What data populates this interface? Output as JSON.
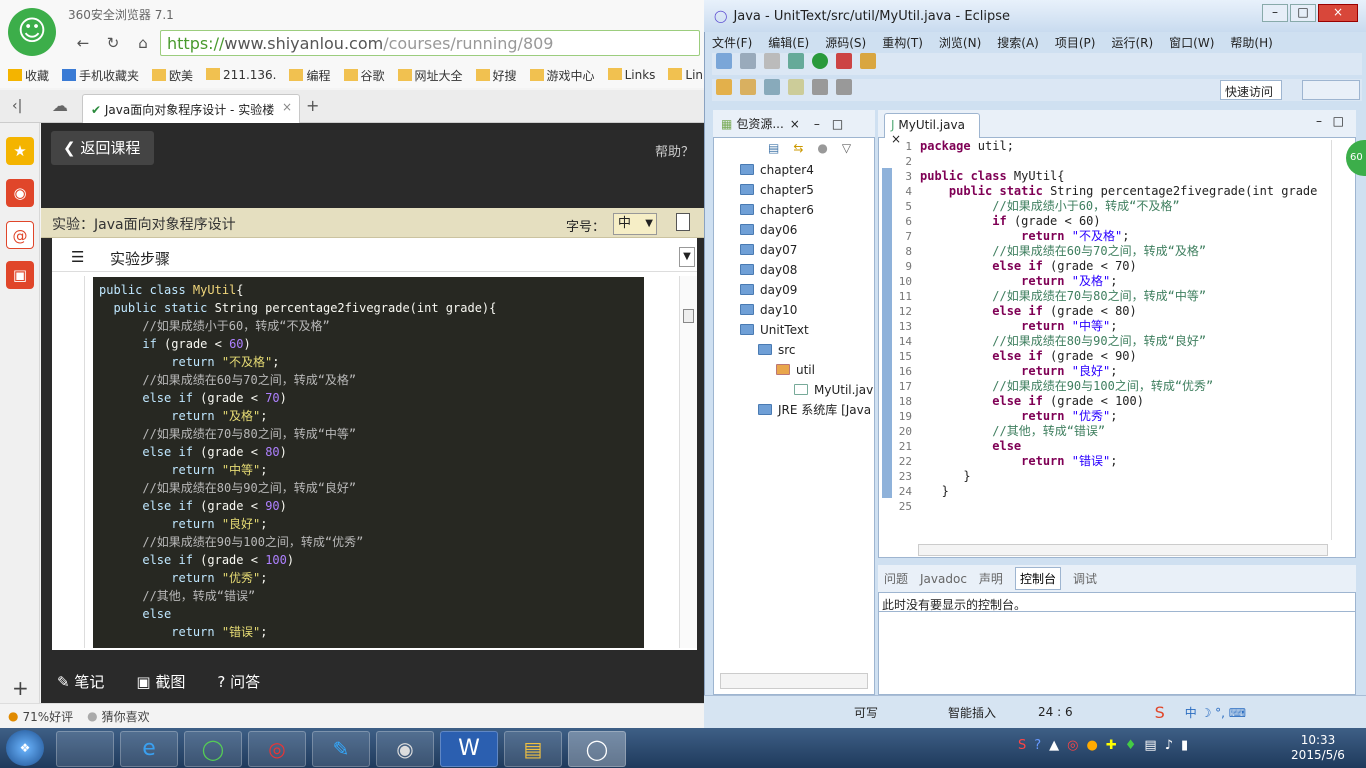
{
  "browser": {
    "app_title": "360安全浏览器 7.1",
    "url_secure": "https://",
    "url_host": "www.shiyanlou.com",
    "url_path": "/courses/running/809",
    "favorites": [
      "收藏",
      "手机收藏夹",
      "欧美",
      "211.136.",
      "编程",
      "谷歌",
      "网址大全",
      "好搜",
      "游戏中心",
      "Links",
      "Link"
    ],
    "tab_title": "Java面向对象程序设计 - 实验楼",
    "new_tab": "+",
    "back_course": "返回课程",
    "help": "帮助？",
    "lab_title": "实验：Java面向对象程序设计",
    "font_label": "字号：",
    "font_value": "中",
    "steps_label": "实验步骤",
    "bottom": {
      "notes": "笔记",
      "screenshot": "截图",
      "qa": "问答"
    },
    "status": {
      "rating": "71%好评",
      "guess": "猜你喜欢"
    },
    "side_add": "+"
  },
  "web_code": [
    [
      [
        "kw",
        "public class "
      ],
      [
        "cls",
        "MyUtil"
      ],
      [
        "",
        "{"
      ]
    ],
    [
      [
        "",
        "  "
      ],
      [
        "kw",
        "public static "
      ],
      [
        "",
        "String percentage2fivegrade(int grade){"
      ]
    ],
    [
      [
        "",
        "      "
      ],
      [
        "com",
        "//如果成绩小于60，转成“不及格”"
      ]
    ],
    [
      [
        "",
        "      "
      ],
      [
        "kw",
        "if "
      ],
      [
        "",
        "(grade < "
      ],
      [
        "num",
        "60"
      ],
      [
        "",
        ")"
      ]
    ],
    [
      [
        "",
        "          "
      ],
      [
        "kw",
        "return "
      ],
      [
        "str",
        "\"不及格\""
      ],
      [
        "",
        ";"
      ]
    ],
    [
      [
        "",
        "      "
      ],
      [
        "com",
        "//如果成绩在60与70之间，转成“及格”"
      ]
    ],
    [
      [
        "",
        "      "
      ],
      [
        "kw",
        "else if "
      ],
      [
        "",
        "(grade < "
      ],
      [
        "num",
        "70"
      ],
      [
        "",
        ")"
      ]
    ],
    [
      [
        "",
        "          "
      ],
      [
        "kw",
        "return "
      ],
      [
        "str",
        "\"及格\""
      ],
      [
        "",
        ";"
      ]
    ],
    [
      [
        "",
        "      "
      ],
      [
        "com",
        "//如果成绩在70与80之间，转成“中等”"
      ]
    ],
    [
      [
        "",
        "      "
      ],
      [
        "kw",
        "else if "
      ],
      [
        "",
        "(grade < "
      ],
      [
        "num",
        "80"
      ],
      [
        "",
        ")"
      ]
    ],
    [
      [
        "",
        "          "
      ],
      [
        "kw",
        "return "
      ],
      [
        "str",
        "\"中等\""
      ],
      [
        "",
        ";"
      ]
    ],
    [
      [
        "",
        "      "
      ],
      [
        "com",
        "//如果成绩在80与90之间，转成“良好”"
      ]
    ],
    [
      [
        "",
        "      "
      ],
      [
        "kw",
        "else if "
      ],
      [
        "",
        "(grade < "
      ],
      [
        "num",
        "90"
      ],
      [
        "",
        ")"
      ]
    ],
    [
      [
        "",
        "          "
      ],
      [
        "kw",
        "return "
      ],
      [
        "str",
        "\"良好\""
      ],
      [
        "",
        ";"
      ]
    ],
    [
      [
        "",
        "      "
      ],
      [
        "com",
        "//如果成绩在90与100之间，转成“优秀”"
      ]
    ],
    [
      [
        "",
        "      "
      ],
      [
        "kw",
        "else if "
      ],
      [
        "",
        "(grade < "
      ],
      [
        "num",
        "100"
      ],
      [
        "",
        ")"
      ]
    ],
    [
      [
        "",
        "          "
      ],
      [
        "kw",
        "return "
      ],
      [
        "str",
        "\"优秀\""
      ],
      [
        "",
        ";"
      ]
    ],
    [
      [
        "",
        "      "
      ],
      [
        "com",
        "//其他，转成“错误”"
      ]
    ],
    [
      [
        "",
        "      "
      ],
      [
        "kw",
        "else"
      ]
    ],
    [
      [
        "",
        "          "
      ],
      [
        "kw",
        "return "
      ],
      [
        "str",
        "\"错误\""
      ],
      [
        "",
        ";"
      ]
    ]
  ],
  "eclipse": {
    "title": "Java - UnitText/src/util/MyUtil.java - Eclipse",
    "menu": [
      "文件(F)",
      "编辑(E)",
      "源码(S)",
      "重构(T)",
      "浏览(N)",
      "搜索(A)",
      "项目(P)",
      "运行(R)",
      "窗口(W)",
      "帮助(H)"
    ],
    "quick_access": "快速访问",
    "pkg_tab": "包资源...",
    "tree": [
      {
        "label": "chapter4",
        "indent": 0
      },
      {
        "label": "chapter5",
        "indent": 0
      },
      {
        "label": "chapter6",
        "indent": 0
      },
      {
        "label": "day06",
        "indent": 0
      },
      {
        "label": "day07",
        "indent": 0
      },
      {
        "label": "day08",
        "indent": 0
      },
      {
        "label": "day09",
        "indent": 0
      },
      {
        "label": "day10",
        "indent": 0
      },
      {
        "label": "UnitText",
        "indent": 0
      },
      {
        "label": "src",
        "indent": 1
      },
      {
        "label": "util",
        "indent": 2
      },
      {
        "label": "MyUtil.jav",
        "indent": 3
      },
      {
        "label": "JRE 系统库 [Java",
        "indent": 1
      }
    ],
    "editor_tab": "MyUtil.java",
    "line_numbers": [
      "1",
      "2",
      "3",
      "4",
      "5",
      "6",
      "7",
      "8",
      "9",
      "10",
      "11",
      "12",
      "13",
      "14",
      "15",
      "16",
      "17",
      "18",
      "19",
      "20",
      "21",
      "22",
      "23",
      "24",
      "25"
    ],
    "code": [
      [
        [
          "ekw",
          "package "
        ],
        [
          "",
          "util;"
        ]
      ],
      [
        [
          "",
          ""
        ]
      ],
      [
        [
          "ekw",
          "public class "
        ],
        [
          "",
          "MyUtil{"
        ]
      ],
      [
        [
          "",
          "    "
        ],
        [
          "ekw",
          "public static "
        ],
        [
          "",
          "String percentage2fivegrade(int grade"
        ]
      ],
      [
        [
          "",
          "          "
        ],
        [
          "ecom",
          "//如果成绩小于60，转成“不及格”"
        ]
      ],
      [
        [
          "",
          "          "
        ],
        [
          "ekw",
          "if "
        ],
        [
          "",
          "(grade < 60)"
        ]
      ],
      [
        [
          "",
          "              "
        ],
        [
          "ekw",
          "return "
        ],
        [
          "estr",
          "\"不及格\""
        ],
        [
          "",
          ";"
        ]
      ],
      [
        [
          "",
          "          "
        ],
        [
          "ecom",
          "//如果成绩在60与70之间，转成“及格”"
        ]
      ],
      [
        [
          "",
          "          "
        ],
        [
          "ekw",
          "else if "
        ],
        [
          "",
          "(grade < 70)"
        ]
      ],
      [
        [
          "",
          "              "
        ],
        [
          "ekw",
          "return "
        ],
        [
          "estr",
          "\"及格\""
        ],
        [
          "",
          ";"
        ]
      ],
      [
        [
          "",
          "          "
        ],
        [
          "ecom",
          "//如果成绩在70与80之间，转成“中等”"
        ]
      ],
      [
        [
          "",
          "          "
        ],
        [
          "ekw",
          "else if "
        ],
        [
          "",
          "(grade < 80)"
        ]
      ],
      [
        [
          "",
          "              "
        ],
        [
          "ekw",
          "return "
        ],
        [
          "estr",
          "\"中等\""
        ],
        [
          "",
          ";"
        ]
      ],
      [
        [
          "",
          "          "
        ],
        [
          "ecom",
          "//如果成绩在80与90之间，转成“良好”"
        ]
      ],
      [
        [
          "",
          "          "
        ],
        [
          "ekw",
          "else if "
        ],
        [
          "",
          "(grade < 90)"
        ]
      ],
      [
        [
          "",
          "              "
        ],
        [
          "ekw",
          "return "
        ],
        [
          "estr",
          "\"良好\""
        ],
        [
          "",
          ";"
        ]
      ],
      [
        [
          "",
          "          "
        ],
        [
          "ecom",
          "//如果成绩在90与100之间，转成“优秀”"
        ]
      ],
      [
        [
          "",
          "          "
        ],
        [
          "ekw",
          "else if "
        ],
        [
          "",
          "(grade < 100)"
        ]
      ],
      [
        [
          "",
          "              "
        ],
        [
          "ekw",
          "return "
        ],
        [
          "estr",
          "\"优秀\""
        ],
        [
          "",
          ";"
        ]
      ],
      [
        [
          "",
          "          "
        ],
        [
          "ecom",
          "//其他，转成“错误”"
        ]
      ],
      [
        [
          "",
          "          "
        ],
        [
          "ekw",
          "else"
        ]
      ],
      [
        [
          "",
          "              "
        ],
        [
          "ekw",
          "return "
        ],
        [
          "estr",
          "\"错误\""
        ],
        [
          "",
          ";"
        ]
      ],
      [
        [
          "",
          "      }"
        ]
      ],
      [
        [
          "",
          "   }"
        ]
      ],
      [
        [
          "",
          ""
        ]
      ]
    ],
    "console_tabs": [
      "问题",
      "Javadoc",
      "声明",
      "控制台",
      "调试"
    ],
    "console_msg": "此时没有要显示的控制台。",
    "status": {
      "writable": "可写",
      "insert": "智能插入",
      "pos": "24 : 6"
    },
    "badge": "60"
  },
  "taskbar": {
    "time": "10:33",
    "date": "2015/5/6"
  },
  "colors": {
    "accent_green": "#3cae4a",
    "code_bg": "#272822",
    "eclipse_bg": "#cfe0f1"
  }
}
